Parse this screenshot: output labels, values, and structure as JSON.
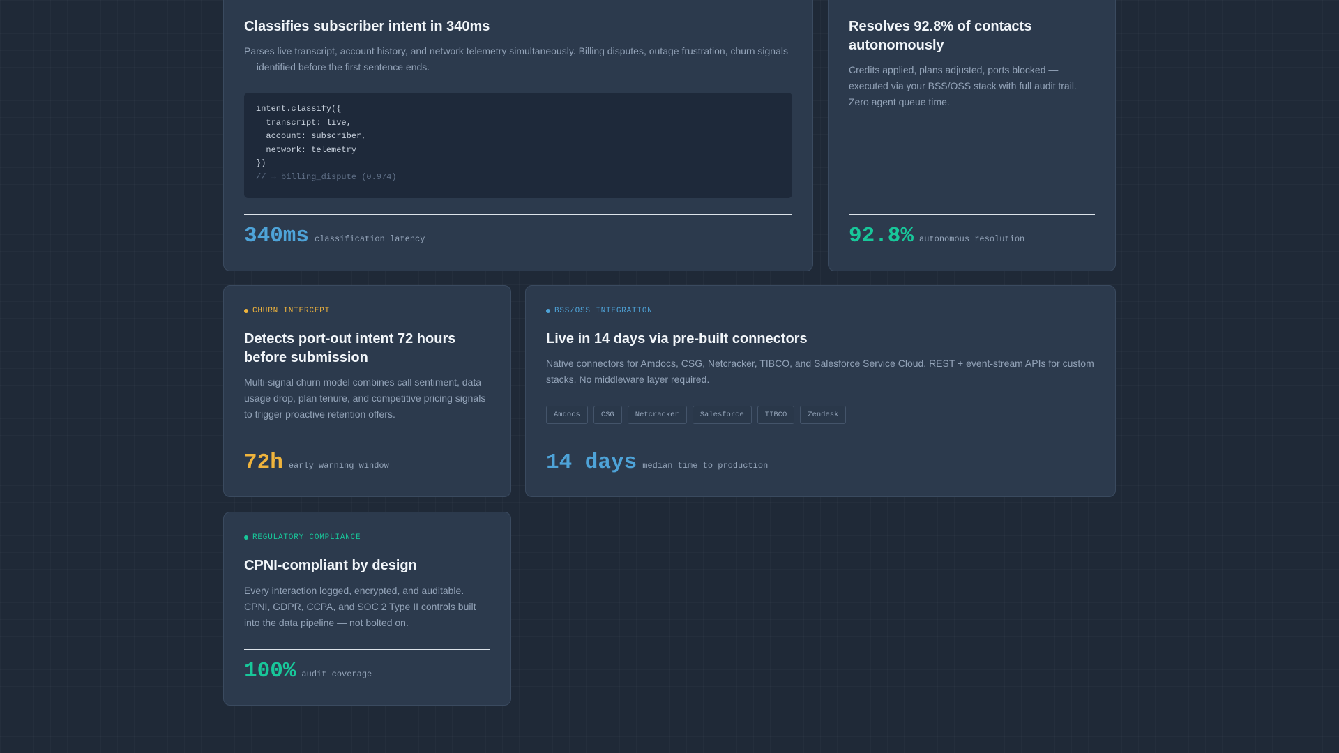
{
  "colors": {
    "background": "#1f2937",
    "card": "#2c3a4d",
    "blue_accent": "#4ea3d8",
    "green_accent": "#18c79a",
    "amber_accent": "#f0b43c"
  },
  "cards": {
    "intent": {
      "title": "Classifies subscriber intent in 340ms",
      "description": "Parses live transcript, account history, and network telemetry simultaneously. Billing disputes, outage frustration, churn signals — identified before the first sentence ends.",
      "code": {
        "line1": "intent.classify({",
        "line2": "  transcript: live,",
        "line3": "  account: subscriber,",
        "line4": "  network: telemetry",
        "line5": "})",
        "comment": "// → billing_dispute (0.974)"
      },
      "metric_value": "340ms",
      "metric_caption": "classification latency"
    },
    "resolve": {
      "title": "Resolves 92.8% of contacts autonomously",
      "description": "Credits applied, plans adjusted, ports blocked — executed via your BSS/OSS stack with full audit trail. Zero agent queue time.",
      "metric_value": "92.8%",
      "metric_caption": "autonomous resolution"
    },
    "churn": {
      "label": "CHURN INTERCEPT",
      "title": "Detects port-out intent 72 hours before submission",
      "description": "Multi-signal churn model combines call sentiment, data usage drop, plan tenure, and competitive pricing signals to trigger proactive retention offers.",
      "metric_value": "72h",
      "metric_caption": "early warning window"
    },
    "bss": {
      "label": "BSS/OSS INTEGRATION",
      "title": "Live in 14 days via pre-built connectors",
      "description": "Native connectors for Amdocs, CSG, Netcracker, TIBCO, and Salesforce Service Cloud. REST + event-stream APIs for custom stacks. No middleware layer required.",
      "chips": [
        "Amdocs",
        "CSG",
        "Netcracker",
        "Salesforce",
        "TIBCO",
        "Zendesk"
      ],
      "metric_value": "14 days",
      "metric_caption": "median time to production"
    },
    "regulatory": {
      "label": "REGULATORY COMPLIANCE",
      "title": "CPNI-compliant by design",
      "description": "Every interaction logged, encrypted, and auditable. CPNI, GDPR, CCPA, and SOC 2 Type II controls built into the data pipeline — not bolted on.",
      "metric_value": "100%",
      "metric_caption": "audit coverage"
    }
  }
}
